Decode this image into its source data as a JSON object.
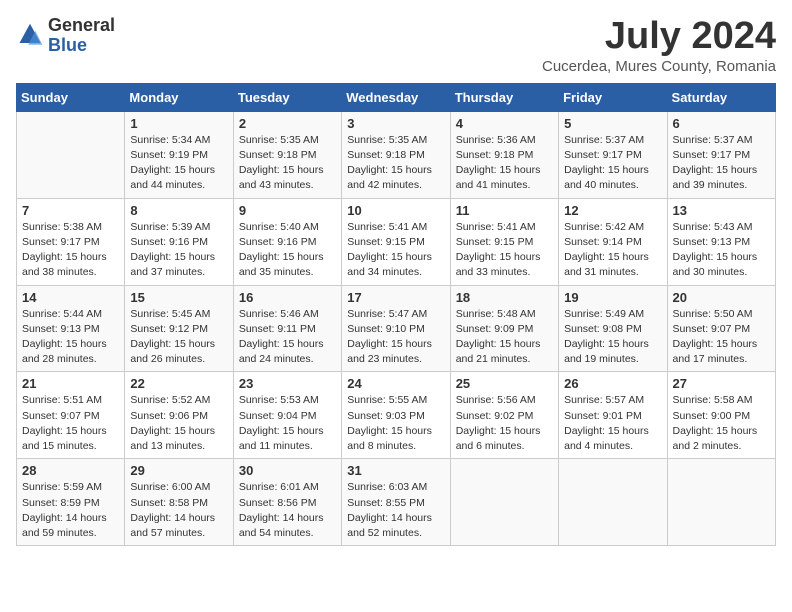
{
  "header": {
    "logo_general": "General",
    "logo_blue": "Blue",
    "month_year": "July 2024",
    "location": "Cucerdea, Mures County, Romania"
  },
  "calendar": {
    "days_of_week": [
      "Sunday",
      "Monday",
      "Tuesday",
      "Wednesday",
      "Thursday",
      "Friday",
      "Saturday"
    ],
    "weeks": [
      [
        {
          "day": "",
          "info": ""
        },
        {
          "day": "1",
          "info": "Sunrise: 5:34 AM\nSunset: 9:19 PM\nDaylight: 15 hours\nand 44 minutes."
        },
        {
          "day": "2",
          "info": "Sunrise: 5:35 AM\nSunset: 9:18 PM\nDaylight: 15 hours\nand 43 minutes."
        },
        {
          "day": "3",
          "info": "Sunrise: 5:35 AM\nSunset: 9:18 PM\nDaylight: 15 hours\nand 42 minutes."
        },
        {
          "day": "4",
          "info": "Sunrise: 5:36 AM\nSunset: 9:18 PM\nDaylight: 15 hours\nand 41 minutes."
        },
        {
          "day": "5",
          "info": "Sunrise: 5:37 AM\nSunset: 9:17 PM\nDaylight: 15 hours\nand 40 minutes."
        },
        {
          "day": "6",
          "info": "Sunrise: 5:37 AM\nSunset: 9:17 PM\nDaylight: 15 hours\nand 39 minutes."
        }
      ],
      [
        {
          "day": "7",
          "info": "Sunrise: 5:38 AM\nSunset: 9:17 PM\nDaylight: 15 hours\nand 38 minutes."
        },
        {
          "day": "8",
          "info": "Sunrise: 5:39 AM\nSunset: 9:16 PM\nDaylight: 15 hours\nand 37 minutes."
        },
        {
          "day": "9",
          "info": "Sunrise: 5:40 AM\nSunset: 9:16 PM\nDaylight: 15 hours\nand 35 minutes."
        },
        {
          "day": "10",
          "info": "Sunrise: 5:41 AM\nSunset: 9:15 PM\nDaylight: 15 hours\nand 34 minutes."
        },
        {
          "day": "11",
          "info": "Sunrise: 5:41 AM\nSunset: 9:15 PM\nDaylight: 15 hours\nand 33 minutes."
        },
        {
          "day": "12",
          "info": "Sunrise: 5:42 AM\nSunset: 9:14 PM\nDaylight: 15 hours\nand 31 minutes."
        },
        {
          "day": "13",
          "info": "Sunrise: 5:43 AM\nSunset: 9:13 PM\nDaylight: 15 hours\nand 30 minutes."
        }
      ],
      [
        {
          "day": "14",
          "info": "Sunrise: 5:44 AM\nSunset: 9:13 PM\nDaylight: 15 hours\nand 28 minutes."
        },
        {
          "day": "15",
          "info": "Sunrise: 5:45 AM\nSunset: 9:12 PM\nDaylight: 15 hours\nand 26 minutes."
        },
        {
          "day": "16",
          "info": "Sunrise: 5:46 AM\nSunset: 9:11 PM\nDaylight: 15 hours\nand 24 minutes."
        },
        {
          "day": "17",
          "info": "Sunrise: 5:47 AM\nSunset: 9:10 PM\nDaylight: 15 hours\nand 23 minutes."
        },
        {
          "day": "18",
          "info": "Sunrise: 5:48 AM\nSunset: 9:09 PM\nDaylight: 15 hours\nand 21 minutes."
        },
        {
          "day": "19",
          "info": "Sunrise: 5:49 AM\nSunset: 9:08 PM\nDaylight: 15 hours\nand 19 minutes."
        },
        {
          "day": "20",
          "info": "Sunrise: 5:50 AM\nSunset: 9:07 PM\nDaylight: 15 hours\nand 17 minutes."
        }
      ],
      [
        {
          "day": "21",
          "info": "Sunrise: 5:51 AM\nSunset: 9:07 PM\nDaylight: 15 hours\nand 15 minutes."
        },
        {
          "day": "22",
          "info": "Sunrise: 5:52 AM\nSunset: 9:06 PM\nDaylight: 15 hours\nand 13 minutes."
        },
        {
          "day": "23",
          "info": "Sunrise: 5:53 AM\nSunset: 9:04 PM\nDaylight: 15 hours\nand 11 minutes."
        },
        {
          "day": "24",
          "info": "Sunrise: 5:55 AM\nSunset: 9:03 PM\nDaylight: 15 hours\nand 8 minutes."
        },
        {
          "day": "25",
          "info": "Sunrise: 5:56 AM\nSunset: 9:02 PM\nDaylight: 15 hours\nand 6 minutes."
        },
        {
          "day": "26",
          "info": "Sunrise: 5:57 AM\nSunset: 9:01 PM\nDaylight: 15 hours\nand 4 minutes."
        },
        {
          "day": "27",
          "info": "Sunrise: 5:58 AM\nSunset: 9:00 PM\nDaylight: 15 hours\nand 2 minutes."
        }
      ],
      [
        {
          "day": "28",
          "info": "Sunrise: 5:59 AM\nSunset: 8:59 PM\nDaylight: 14 hours\nand 59 minutes."
        },
        {
          "day": "29",
          "info": "Sunrise: 6:00 AM\nSunset: 8:58 PM\nDaylight: 14 hours\nand 57 minutes."
        },
        {
          "day": "30",
          "info": "Sunrise: 6:01 AM\nSunset: 8:56 PM\nDaylight: 14 hours\nand 54 minutes."
        },
        {
          "day": "31",
          "info": "Sunrise: 6:03 AM\nSunset: 8:55 PM\nDaylight: 14 hours\nand 52 minutes."
        },
        {
          "day": "",
          "info": ""
        },
        {
          "day": "",
          "info": ""
        },
        {
          "day": "",
          "info": ""
        }
      ]
    ]
  }
}
